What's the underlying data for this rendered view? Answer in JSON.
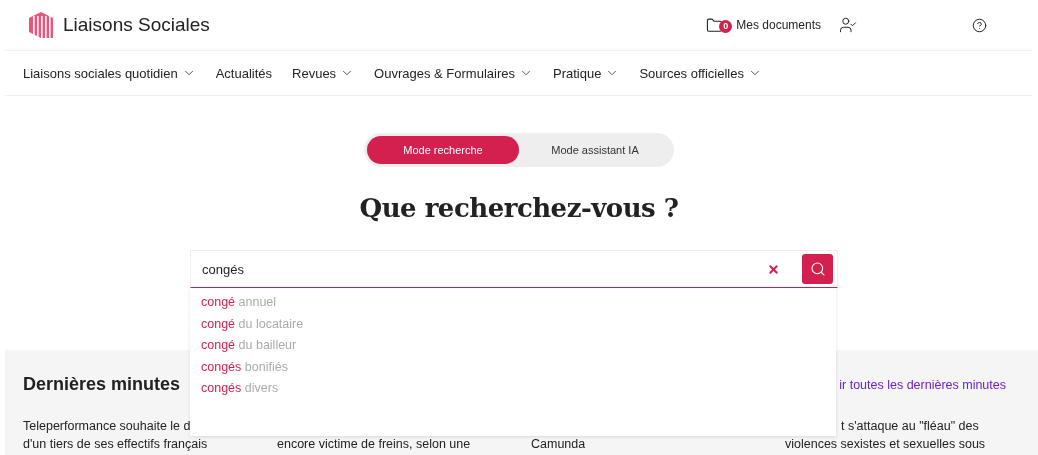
{
  "header": {
    "brand": "Liaisons Sociales",
    "documents_count": "0",
    "documents_label": "Mes documents"
  },
  "nav": [
    {
      "label": "Liaisons sociales quotidien",
      "has_menu": true
    },
    {
      "label": "Actualités",
      "has_menu": false
    },
    {
      "label": "Revues",
      "has_menu": true
    },
    {
      "label": "Ouvrages & Formulaires",
      "has_menu": true
    },
    {
      "label": "Pratique",
      "has_menu": true
    },
    {
      "label": "Sources officielles",
      "has_menu": true
    }
  ],
  "modes": [
    {
      "label": "Mode recherche",
      "selected": true
    },
    {
      "label": "Mode assistant IA",
      "selected": false
    }
  ],
  "title": "Que recherchez-vous ?",
  "search": {
    "value": "congés"
  },
  "suggestions": [
    {
      "match": "congé",
      "rest": "annuel"
    },
    {
      "match": "congé",
      "rest": "du locataire"
    },
    {
      "match": "congé",
      "rest": "du bailleur"
    },
    {
      "match": "congés",
      "rest": "bonifiés"
    },
    {
      "match": "congés",
      "rest": "divers"
    }
  ],
  "latest": {
    "heading": "Dernières minutes",
    "link": "ir toutes les dernières minutes",
    "news": [
      {
        "top": "Teleperformance souhaite le d",
        "bottom": "d'un tiers de ses effectifs français"
      },
      {
        "bottom": "encore victime de freins, selon une"
      },
      {
        "bottom": "Camunda"
      },
      {
        "top": "t s'attaque au \"fléau\" des",
        "bottom": "violences sexistes et sexuelles sous"
      }
    ]
  }
}
